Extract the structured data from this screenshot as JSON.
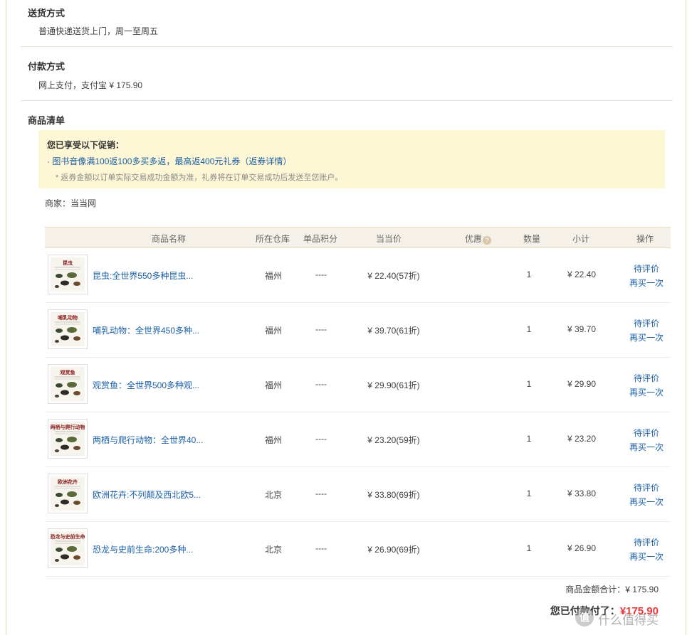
{
  "delivery": {
    "title": "送货方式",
    "text": "普通快递送货上门，周一至周五"
  },
  "payment": {
    "title": "付款方式",
    "text": "网上支付，支付宝  ¥ 175.90"
  },
  "goods": {
    "title": "商品清单",
    "promo": {
      "title": "您已享受以下促销：",
      "bullet": "· ",
      "link_text": "图书音像满100返100多买多返，最高返400元礼券",
      "detail_link": "（返券详情）",
      "note": "* 返券金额以订单实际交易成功金额为准，礼券将在订单交易成功后发送至您账户。"
    },
    "merchant": "商家：当当网",
    "columns": {
      "name": "商品名称",
      "warehouse": "所在仓库",
      "points": "单品积分",
      "price": "当当价",
      "discount": "优惠",
      "qty": "数量",
      "subtotal": "小计",
      "action": "操作"
    },
    "help_icon": "?",
    "items": [
      {
        "name": "昆虫:全世界550多种昆虫...",
        "cover_title": "昆虫",
        "warehouse": "福州",
        "points": "----",
        "price": "¥ 22.40(57折)",
        "qty": "1",
        "subtotal": "¥ 22.40",
        "action_review": "待评价",
        "action_rebuy": "再买一次"
      },
      {
        "name": "哺乳动物：全世界450多种...",
        "cover_title": "哺乳动物",
        "warehouse": "福州",
        "points": "----",
        "price": "¥ 39.70(61折)",
        "qty": "1",
        "subtotal": "¥ 39.70",
        "action_review": "待评价",
        "action_rebuy": "再买一次"
      },
      {
        "name": "观赏鱼：全世界500多种观...",
        "cover_title": "观赏鱼",
        "warehouse": "福州",
        "points": "----",
        "price": "¥ 29.90(61折)",
        "qty": "1",
        "subtotal": "¥ 29.90",
        "action_review": "待评价",
        "action_rebuy": "再买一次"
      },
      {
        "name": "两栖与爬行动物：全世界40...",
        "cover_title": "两栖与爬行动物",
        "warehouse": "福州",
        "points": "----",
        "price": "¥ 23.20(59折)",
        "qty": "1",
        "subtotal": "¥ 23.20",
        "action_review": "待评价",
        "action_rebuy": "再买一次"
      },
      {
        "name": "欧洲花卉:不列颠及西北欧5...",
        "cover_title": "欧洲花卉",
        "warehouse": "北京",
        "points": "----",
        "price": "¥ 33.80(69折)",
        "qty": "1",
        "subtotal": "¥ 33.80",
        "action_review": "待评价",
        "action_rebuy": "再买一次"
      },
      {
        "name": "恐龙与史前生命:200多种...",
        "cover_title": "恐龙与史前生命",
        "warehouse": "北京",
        "points": "----",
        "price": "¥ 26.90(69折)",
        "qty": "1",
        "subtotal": "¥ 26.90",
        "action_review": "待评价",
        "action_rebuy": "再买一次"
      }
    ]
  },
  "summary": {
    "total_label": "商品金额合计：",
    "total_value": "¥ 175.90",
    "paid_label": "您已付款付了：",
    "paid_value": "¥175.90"
  },
  "watermark": {
    "icon_text": "值",
    "text": "什么值得买"
  },
  "colors": {
    "link": "#1a5fa8",
    "promo_bg": "#fdf7d5",
    "header_bg": "#f6f1e8",
    "price_red": "#e4393c"
  }
}
